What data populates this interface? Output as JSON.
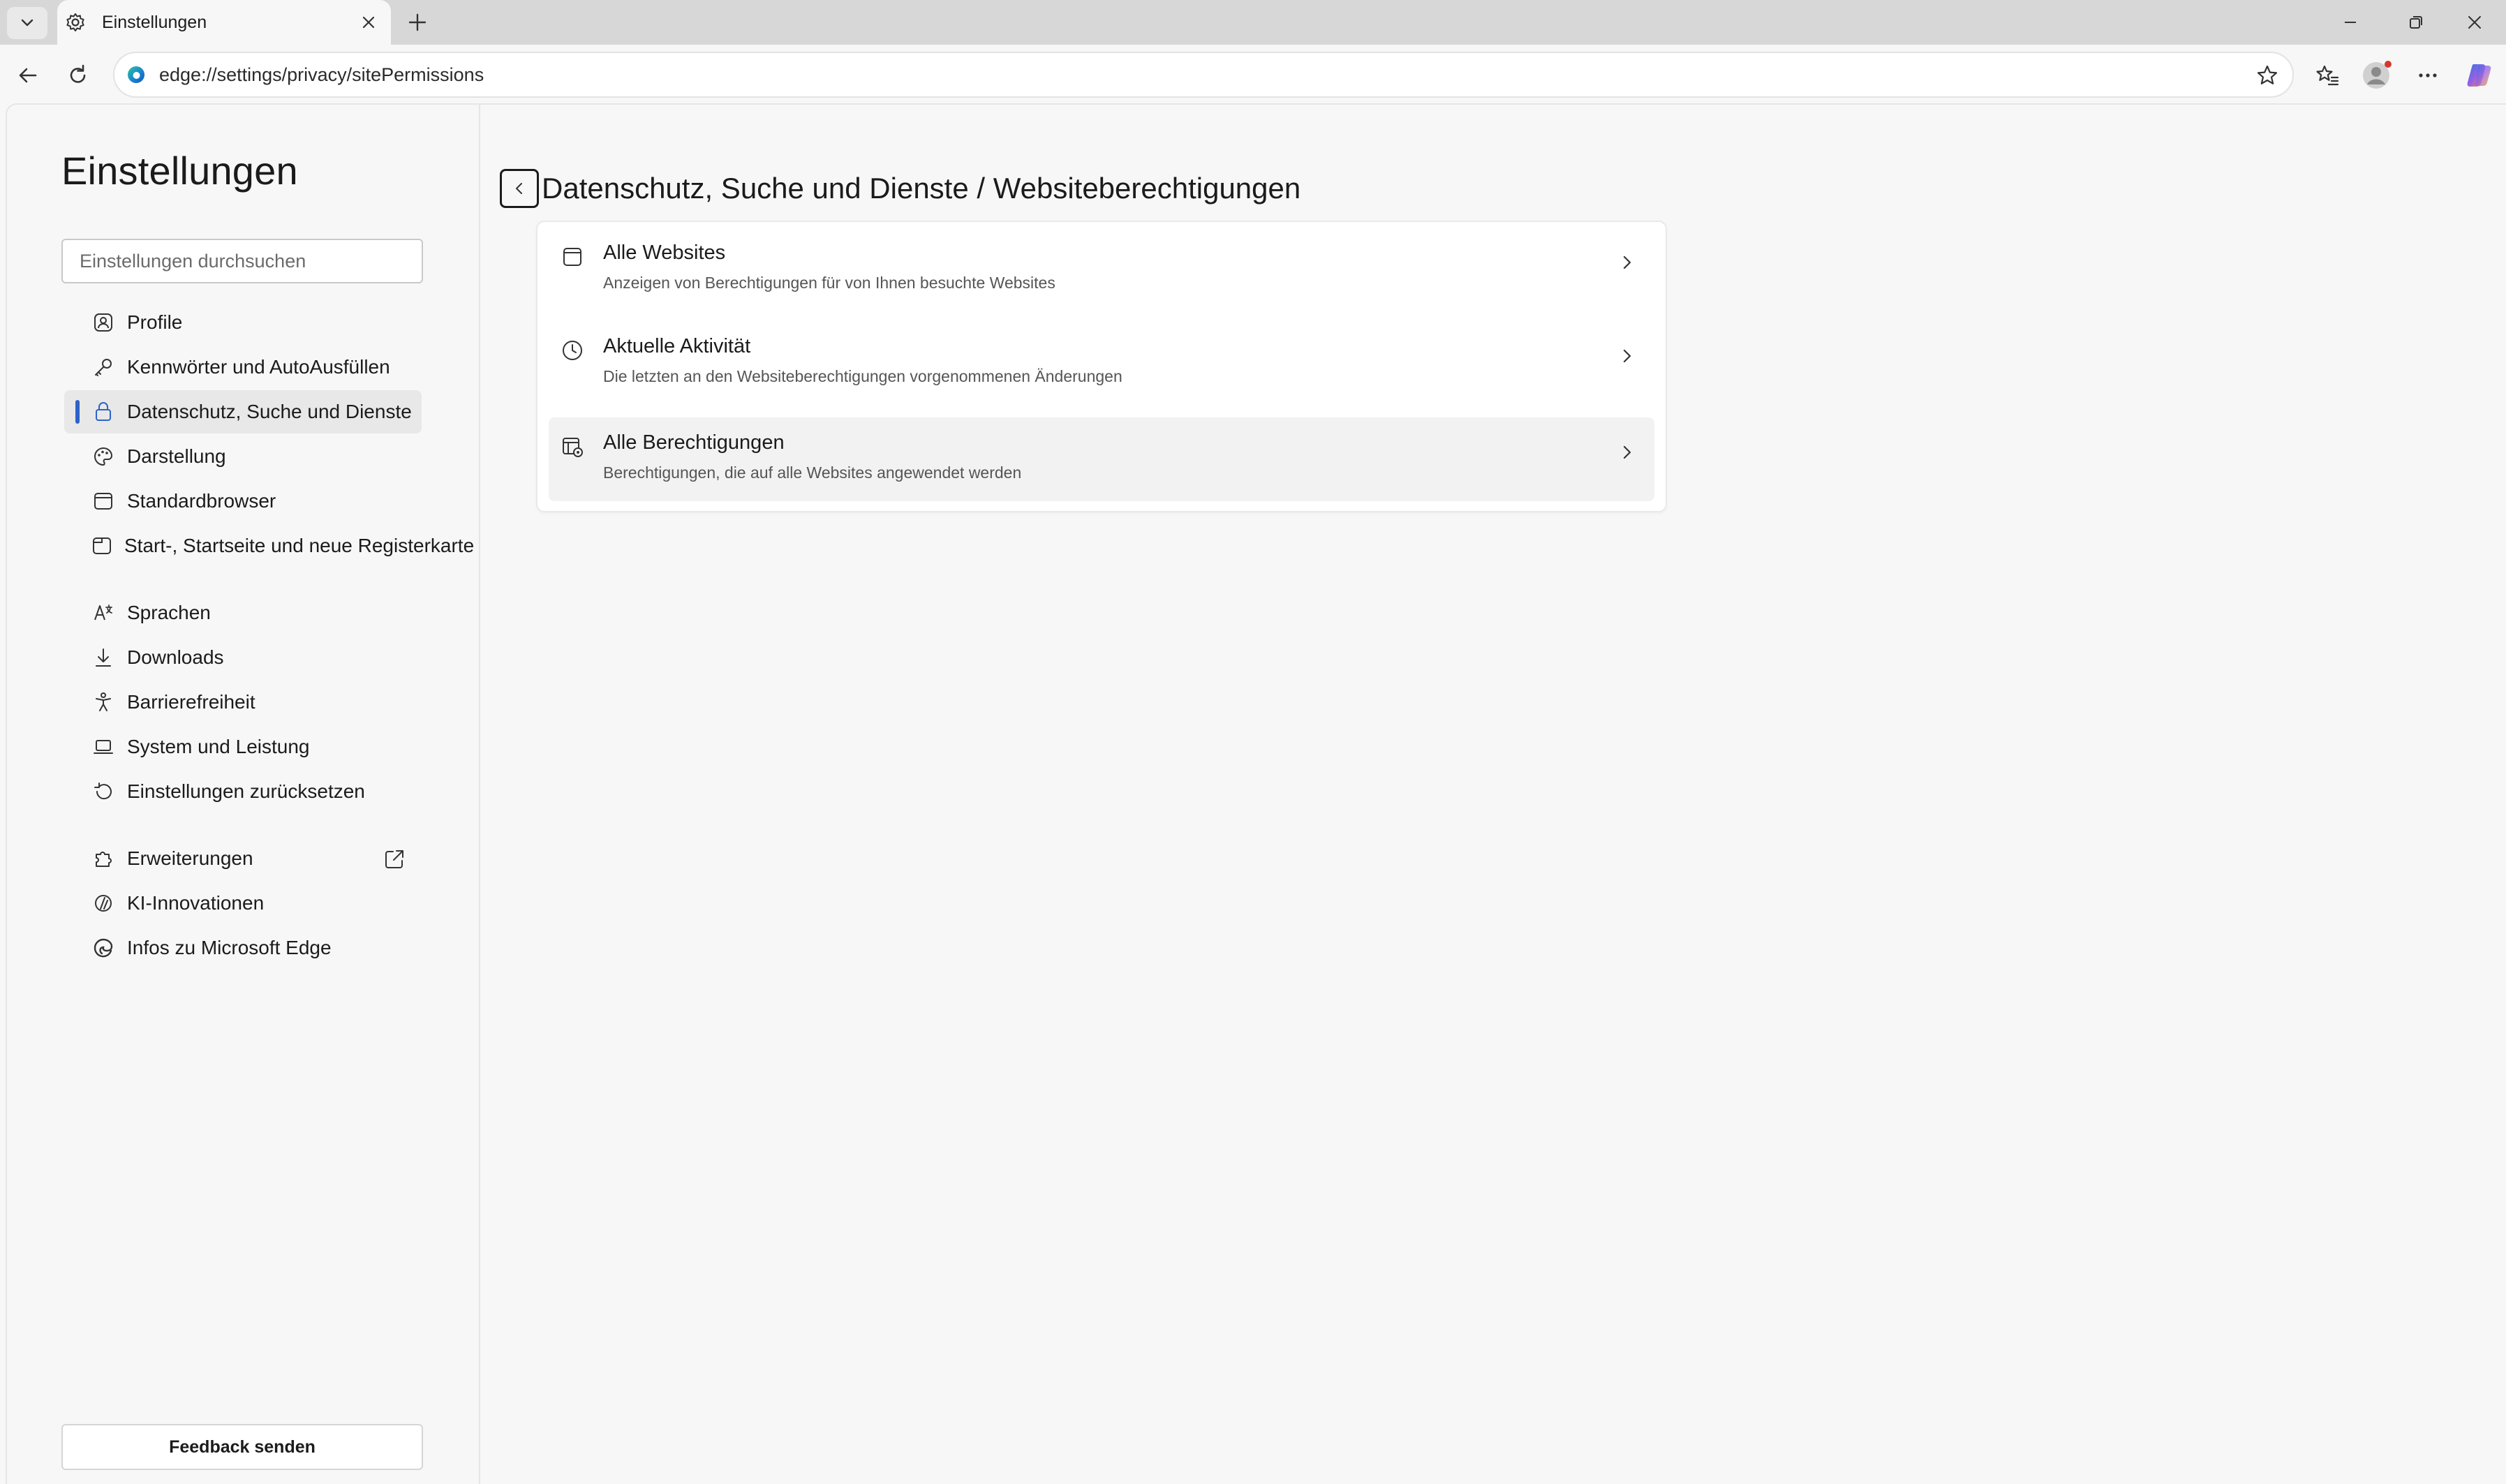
{
  "browser": {
    "tab_title": "Einstellungen",
    "url": "edge://settings/privacy/sitePermissions"
  },
  "sidebar": {
    "title": "Einstellungen",
    "search_placeholder": "Einstellungen durchsuchen",
    "items": [
      {
        "label": "Profile",
        "icon": "profile-icon"
      },
      {
        "label": "Kennwörter und AutoAusfüllen",
        "icon": "key-icon"
      },
      {
        "label": "Datenschutz, Suche und Dienste",
        "icon": "lock-icon",
        "active": true
      },
      {
        "label": "Darstellung",
        "icon": "palette-icon"
      },
      {
        "label": "Standardbrowser",
        "icon": "browser-icon"
      },
      {
        "label": "Start-, Startseite und neue Registerkarte",
        "icon": "home-tab-icon"
      },
      {
        "label": "Sprachen",
        "icon": "language-icon"
      },
      {
        "label": "Downloads",
        "icon": "download-icon"
      },
      {
        "label": "Barrierefreiheit",
        "icon": "accessibility-icon"
      },
      {
        "label": "System und Leistung",
        "icon": "laptop-icon"
      },
      {
        "label": "Einstellungen zurücksetzen",
        "icon": "reset-icon"
      },
      {
        "label": "Erweiterungen",
        "icon": "puzzle-icon"
      },
      {
        "label": "KI-Innovationen",
        "icon": "ai-icon"
      },
      {
        "label": "Infos zu Microsoft Edge",
        "icon": "edge-logo-icon"
      }
    ],
    "feedback_label": "Feedback senden"
  },
  "main": {
    "breadcrumb": "Datenschutz, Suche und Dienste / Websiteberechtigungen",
    "rows": [
      {
        "title": "Alle Websites",
        "subtitle": "Anzeigen von Berechtigungen für von Ihnen besuchte Websites",
        "icon": "site-page-icon"
      },
      {
        "title": "Aktuelle Aktivität",
        "subtitle": "Die letzten an den Websiteberechtigungen vorgenommenen Änderungen",
        "icon": "clock-icon"
      },
      {
        "title": "Alle Berechtigungen",
        "subtitle": "Berechtigungen, die auf alle Websites angewendet werden",
        "icon": "permissions-icon"
      }
    ]
  },
  "colors": {
    "accent": "#2f62c9",
    "titlebar": "#d7d7d7",
    "background": "#f7f7f7"
  }
}
